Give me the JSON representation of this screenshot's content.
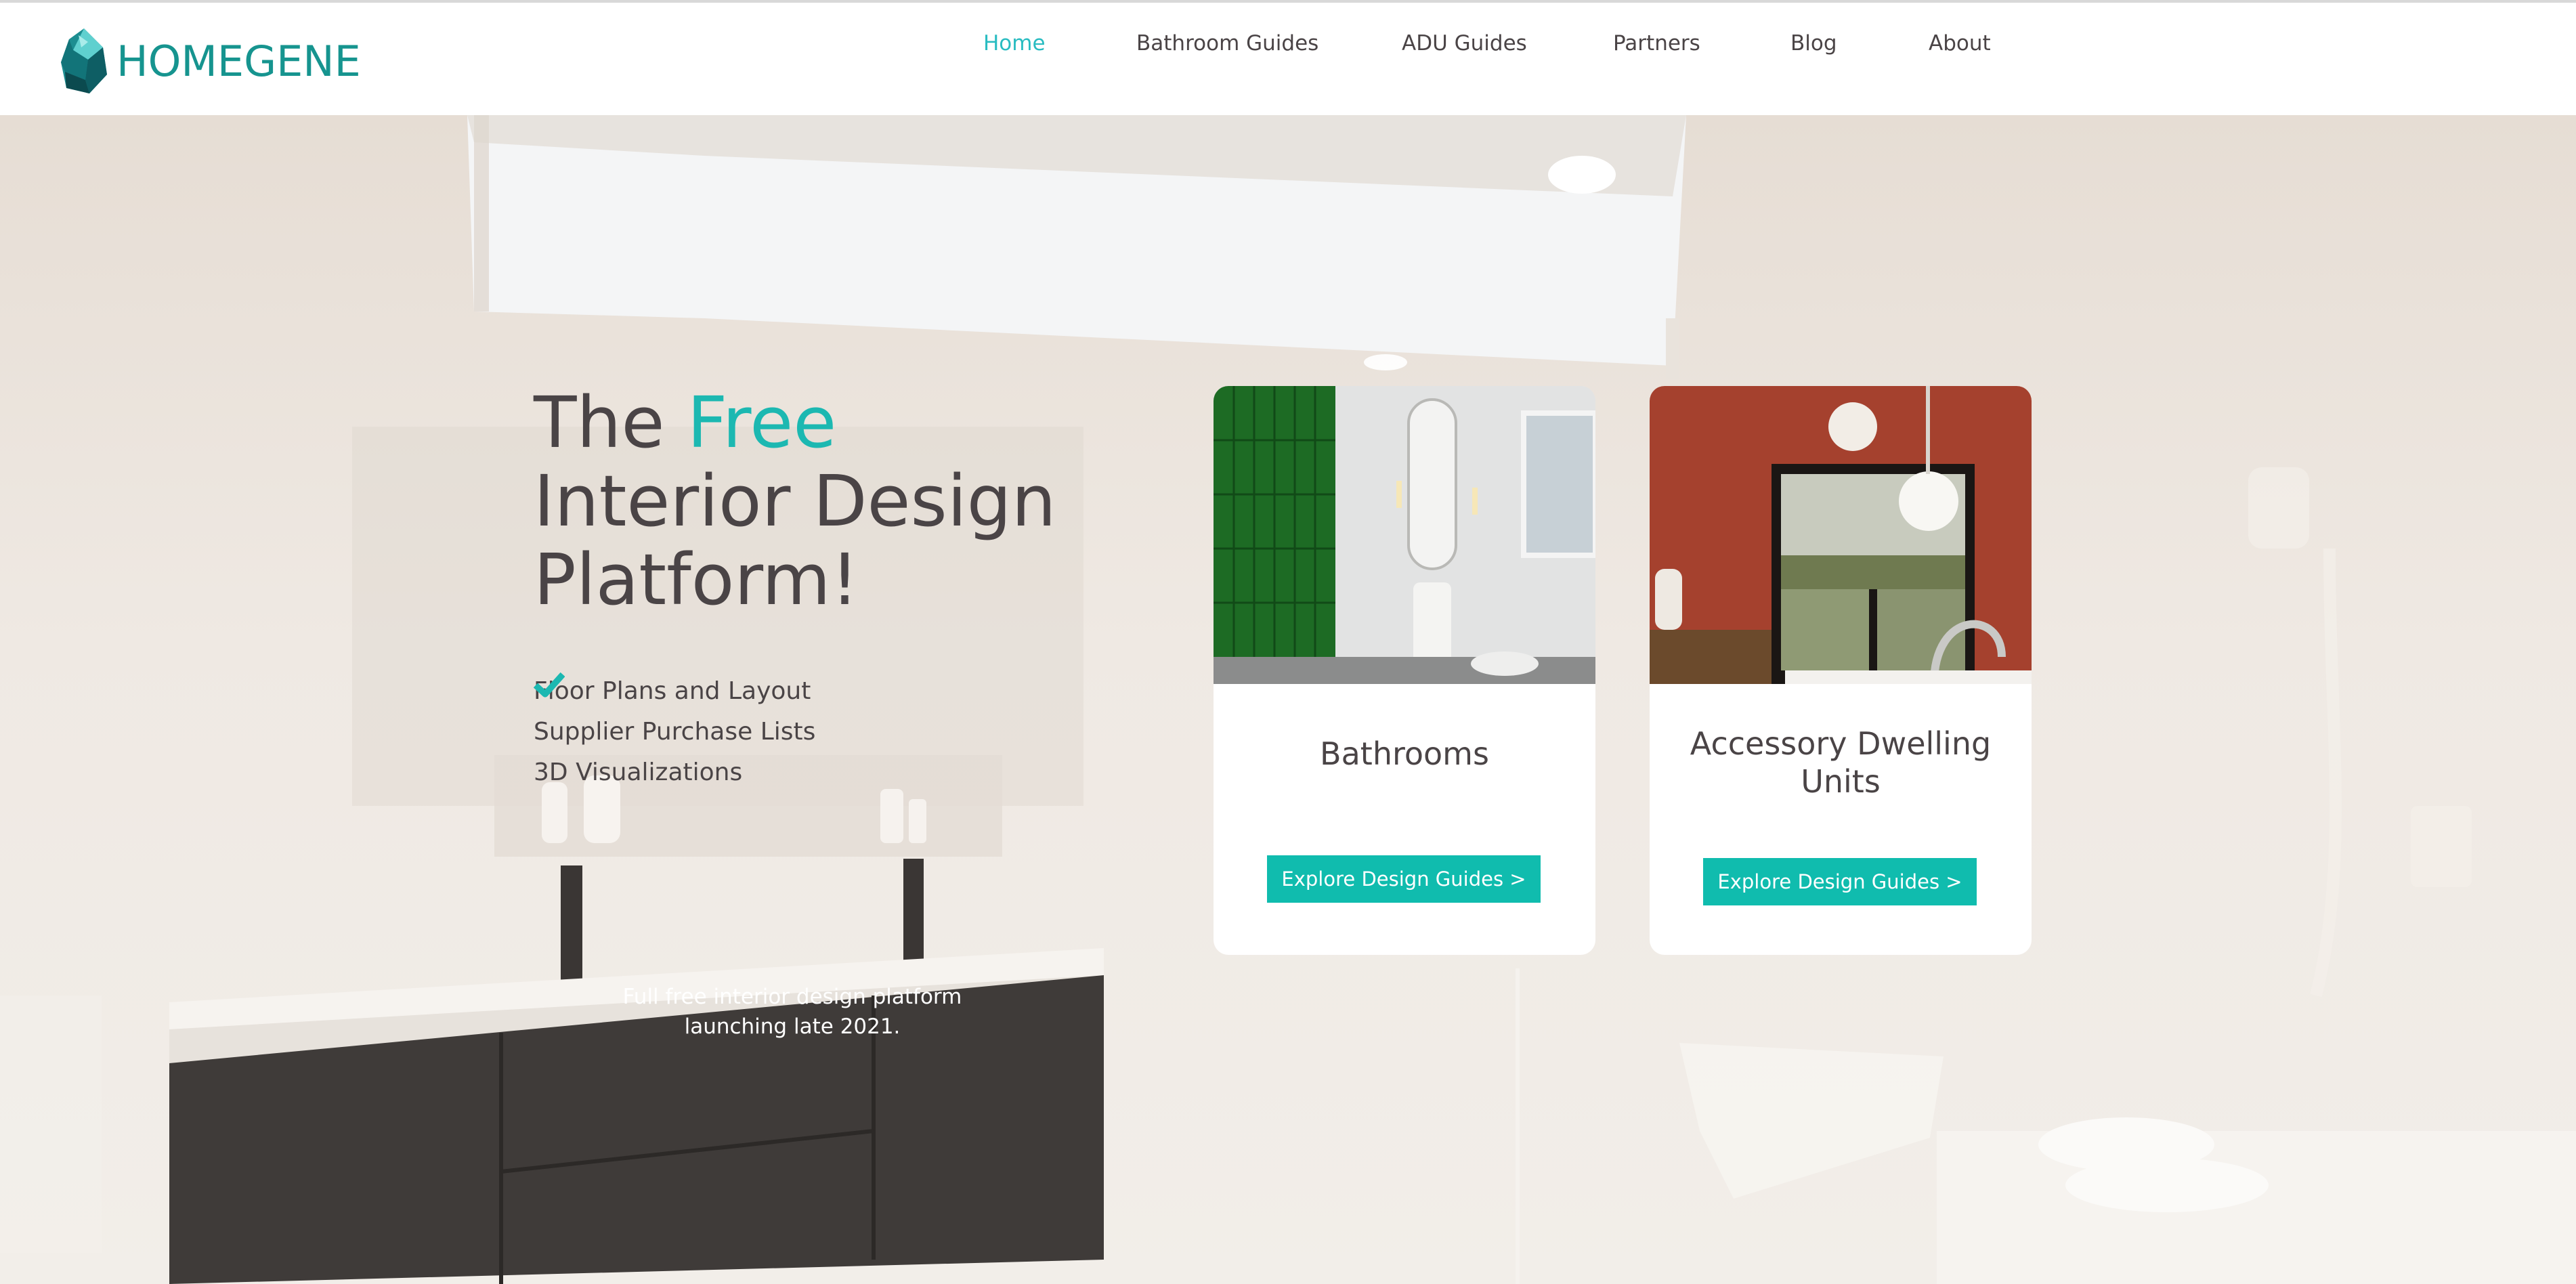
{
  "brand": {
    "name": "HOMEGENE",
    "icon": "gem-logo-icon",
    "color": "#16948f"
  },
  "nav": {
    "items": [
      {
        "label": "Home",
        "active": true
      },
      {
        "label": "Bathroom Guides",
        "active": false
      },
      {
        "label": "ADU Guides",
        "active": false
      },
      {
        "label": "Partners",
        "active": false
      },
      {
        "label": "Blog",
        "active": false
      },
      {
        "label": "About",
        "active": false
      }
    ],
    "active_color": "#29bcc1"
  },
  "hero": {
    "headline_prefix": "The ",
    "headline_accent": "Free",
    "headline_line2": "Interior Design",
    "headline_line3": "Platform!",
    "features": [
      {
        "label": "Floor Plans and Layout",
        "icon": "checkmark-icon"
      },
      {
        "label": "Supplier Purchase Lists",
        "icon": "checkmark-icon"
      },
      {
        "label": "3D Visualizations",
        "icon": "checkmark-icon"
      }
    ],
    "launch_line1": "Full free interior design platform",
    "launch_line2": "launching late 2021.",
    "accent_color": "#1cb8b1"
  },
  "cards": [
    {
      "title": "Bathrooms",
      "button": "Explore Design Guides >",
      "image": "green-tiled-shower-bathroom-photo"
    },
    {
      "title_line1": "Accessory Dwelling",
      "title_line2": "Units",
      "button": "Explore Design Guides >",
      "image": "terracotta-room-sliding-door-photo"
    }
  ],
  "button_color": "#10bcae"
}
